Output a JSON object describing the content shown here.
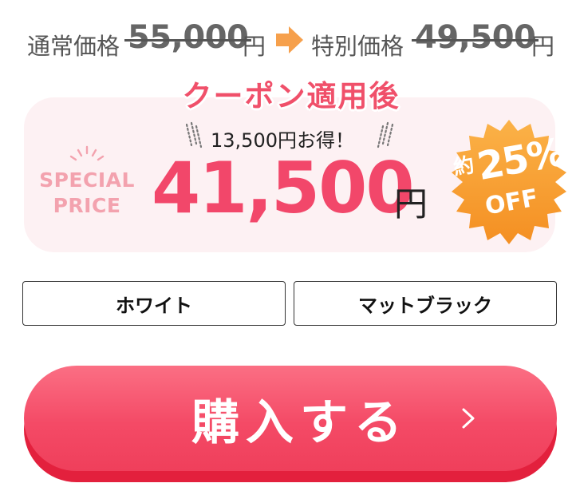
{
  "pricing": {
    "regular_label": "通常価格",
    "regular_price": "55,000",
    "regular_unit": "円",
    "arrow_icon": "right-arrow-icon",
    "special_label": "特別価格",
    "special_price": "49,500",
    "special_unit": "円"
  },
  "offer": {
    "title": "クーポン適用後",
    "savings": "13,500円お得！",
    "special_badge_line1": "SPECIAL",
    "special_badge_line2": "PRICE",
    "price": "41,500",
    "price_unit": "円",
    "discount_prefix": "約",
    "discount_value": "25%",
    "discount_suffix": "OFF",
    "badge_color": "#f9a23a"
  },
  "options": {
    "white_label": "ホワイト",
    "black_label": "マットブラック"
  },
  "purchase": {
    "button_label": "購入する",
    "button_color": "#f44a66",
    "chevron_icon": "chevron-right-icon"
  }
}
